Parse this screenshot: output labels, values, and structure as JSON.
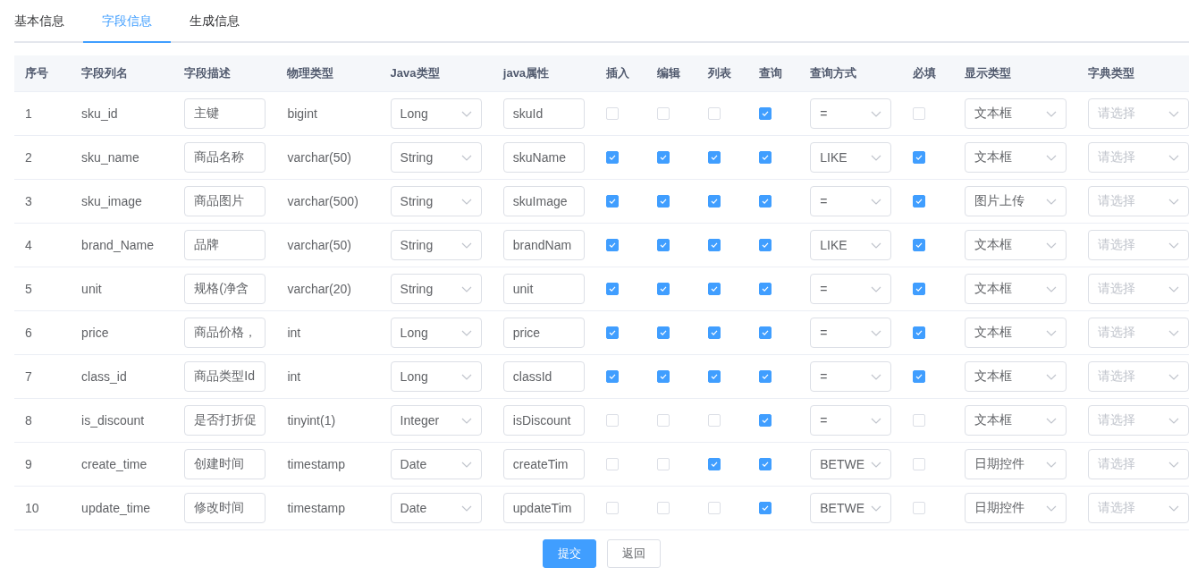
{
  "tabs": [
    {
      "label": "基本信息",
      "selected": false
    },
    {
      "label": "字段信息",
      "selected": true
    },
    {
      "label": "生成信息",
      "selected": false
    }
  ],
  "table": {
    "columns": [
      "序号",
      "字段列名",
      "字段描述",
      "物理类型",
      "Java类型",
      "java属性",
      "插入",
      "编辑",
      "列表",
      "查询",
      "查询方式",
      "必填",
      "显示类型",
      "字典类型"
    ],
    "rows": [
      {
        "index": "1",
        "column_name": "sku_id",
        "description": "主键",
        "physical_type": "bigint",
        "java_type": "Long",
        "java_field": "skuId",
        "insert": false,
        "edit": false,
        "list": false,
        "query": true,
        "query_type": "=",
        "required": false,
        "display_type": "文本框",
        "dict_type_placeholder": "请选择"
      },
      {
        "index": "2",
        "column_name": "sku_name",
        "description": "商品名称",
        "physical_type": "varchar(50)",
        "java_type": "String",
        "java_field": "skuName",
        "insert": true,
        "edit": true,
        "list": true,
        "query": true,
        "query_type": "LIKE",
        "required": true,
        "display_type": "文本框",
        "dict_type_placeholder": "请选择"
      },
      {
        "index": "3",
        "column_name": "sku_image",
        "description": "商品图片",
        "physical_type": "varchar(500)",
        "java_type": "String",
        "java_field": "skuImage",
        "insert": true,
        "edit": true,
        "list": true,
        "query": true,
        "query_type": "=",
        "required": true,
        "display_type": "图片上传",
        "dict_type_placeholder": "请选择"
      },
      {
        "index": "4",
        "column_name": "brand_Name",
        "description": "品牌",
        "physical_type": "varchar(50)",
        "java_type": "String",
        "java_field": "brandNam",
        "insert": true,
        "edit": true,
        "list": true,
        "query": true,
        "query_type": "LIKE",
        "required": true,
        "display_type": "文本框",
        "dict_type_placeholder": "请选择"
      },
      {
        "index": "5",
        "column_name": "unit",
        "description": "规格(净含",
        "physical_type": "varchar(20)",
        "java_type": "String",
        "java_field": "unit",
        "insert": true,
        "edit": true,
        "list": true,
        "query": true,
        "query_type": "=",
        "required": true,
        "display_type": "文本框",
        "dict_type_placeholder": "请选择"
      },
      {
        "index": "6",
        "column_name": "price",
        "description": "商品价格，",
        "physical_type": "int",
        "java_type": "Long",
        "java_field": "price",
        "insert": true,
        "edit": true,
        "list": true,
        "query": true,
        "query_type": "=",
        "required": true,
        "display_type": "文本框",
        "dict_type_placeholder": "请选择"
      },
      {
        "index": "7",
        "column_name": "class_id",
        "description": "商品类型Id",
        "physical_type": "int",
        "java_type": "Long",
        "java_field": "classId",
        "insert": true,
        "edit": true,
        "list": true,
        "query": true,
        "query_type": "=",
        "required": true,
        "display_type": "文本框",
        "dict_type_placeholder": "请选择"
      },
      {
        "index": "8",
        "column_name": "is_discount",
        "description": "是否打折促",
        "physical_type": "tinyint(1)",
        "java_type": "Integer",
        "java_field": "isDiscount",
        "insert": false,
        "edit": false,
        "list": false,
        "query": true,
        "query_type": "=",
        "required": false,
        "display_type": "文本框",
        "dict_type_placeholder": "请选择"
      },
      {
        "index": "9",
        "column_name": "create_time",
        "description": "创建时间",
        "physical_type": "timestamp",
        "java_type": "Date",
        "java_field": "createTim",
        "insert": false,
        "edit": false,
        "list": true,
        "query": true,
        "query_type": "BETWE",
        "required": false,
        "display_type": "日期控件",
        "dict_type_placeholder": "请选择"
      },
      {
        "index": "10",
        "column_name": "update_time",
        "description": "修改时间",
        "physical_type": "timestamp",
        "java_type": "Date",
        "java_field": "updateTim",
        "insert": false,
        "edit": false,
        "list": false,
        "query": true,
        "query_type": "BETWE",
        "required": false,
        "display_type": "日期控件",
        "dict_type_placeholder": "请选择"
      }
    ]
  },
  "buttons": [
    {
      "label": "提交",
      "kind": "primary"
    },
    {
      "label": "返回",
      "kind": "default"
    }
  ]
}
